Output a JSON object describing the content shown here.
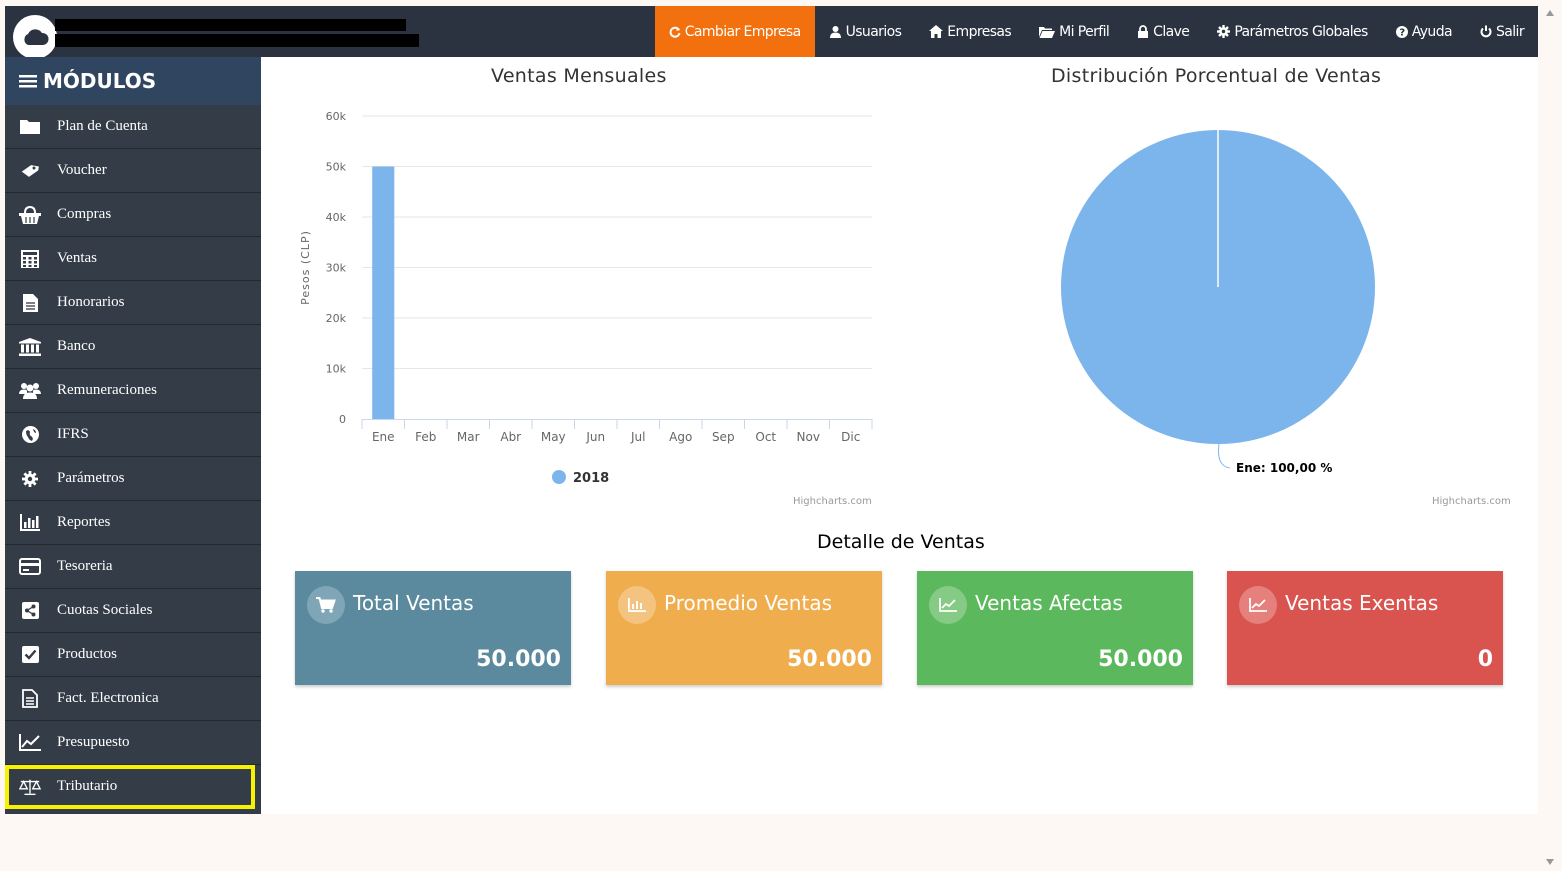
{
  "topnav": [
    {
      "label": "Cambiar Empresa",
      "icon": "refresh-icon",
      "active": true
    },
    {
      "label": "Usuarios",
      "icon": "user-icon"
    },
    {
      "label": "Empresas",
      "icon": "home-icon"
    },
    {
      "label": "Mi Perfil",
      "icon": "folder-open-icon"
    },
    {
      "label": "Clave",
      "icon": "lock-icon"
    },
    {
      "label": "Parámetros Globales",
      "icon": "gear-icon"
    },
    {
      "label": "Ayuda",
      "icon": "question-icon"
    },
    {
      "label": "Salir",
      "icon": "power-icon"
    }
  ],
  "sidebar": {
    "title": "MÓDULOS",
    "items": [
      {
        "label": "Plan de Cuenta",
        "icon": "folder-icon"
      },
      {
        "label": "Voucher",
        "icon": "ticket-icon"
      },
      {
        "label": "Compras",
        "icon": "basket-icon"
      },
      {
        "label": "Ventas",
        "icon": "calculator-icon"
      },
      {
        "label": "Honorarios",
        "icon": "file-text-icon"
      },
      {
        "label": "Banco",
        "icon": "bank-icon"
      },
      {
        "label": "Remuneraciones",
        "icon": "users-icon"
      },
      {
        "label": "IFRS",
        "icon": "globe-icon"
      },
      {
        "label": "Parámetros",
        "icon": "gear-icon"
      },
      {
        "label": "Reportes",
        "icon": "bar-chart-icon"
      },
      {
        "label": "Tesoreria",
        "icon": "credit-card-icon"
      },
      {
        "label": "Cuotas Sociales",
        "icon": "share-icon"
      },
      {
        "label": "Productos",
        "icon": "check-square-icon"
      },
      {
        "label": "Fact. Electronica",
        "icon": "file-lines-icon"
      },
      {
        "label": "Presupuesto",
        "icon": "line-chart-icon"
      },
      {
        "label": "Tributario",
        "icon": "balance-scale-icon",
        "highlighted": true
      }
    ]
  },
  "charts": {
    "credits": "Highcharts.com"
  },
  "chart_data": [
    {
      "type": "bar",
      "title": "Ventas Mensuales",
      "ylabel": "Pesos (CLP)",
      "categories": [
        "Ene",
        "Feb",
        "Mar",
        "Abr",
        "May",
        "Jun",
        "Jul",
        "Ago",
        "Sep",
        "Oct",
        "Nov",
        "Dic"
      ],
      "series": [
        {
          "name": "2018",
          "values": [
            50000,
            0,
            0,
            0,
            0,
            0,
            0,
            0,
            0,
            0,
            0,
            0
          ],
          "color": "#7cb5ec"
        }
      ],
      "ylim": [
        0,
        60000
      ],
      "yticks": [
        "0",
        "10k",
        "20k",
        "30k",
        "40k",
        "50k",
        "60k"
      ],
      "legend": "bottom-center",
      "grid": true
    },
    {
      "type": "pie",
      "title": "Distribución Porcentual de Ventas",
      "slices": [
        {
          "label": "Ene",
          "value": 100,
          "color": "#7cb5ec"
        }
      ],
      "data_label": "Ene: 100,00 %"
    }
  ],
  "detalle": {
    "title": "Detalle de Ventas",
    "cards": [
      {
        "label": "Total Ventas",
        "value": "50.000",
        "color": "#5b8a9e",
        "icon": "cart-icon"
      },
      {
        "label": "Promedio Ventas",
        "value": "50.000",
        "color": "#f0ad4e",
        "icon": "bar-chart-icon"
      },
      {
        "label": "Ventas Afectas",
        "value": "50.000",
        "color": "#5cb85c",
        "icon": "line-chart-icon"
      },
      {
        "label": "Ventas Exentas",
        "value": "0",
        "color": "#d9534f",
        "icon": "line-chart-icon"
      }
    ]
  }
}
